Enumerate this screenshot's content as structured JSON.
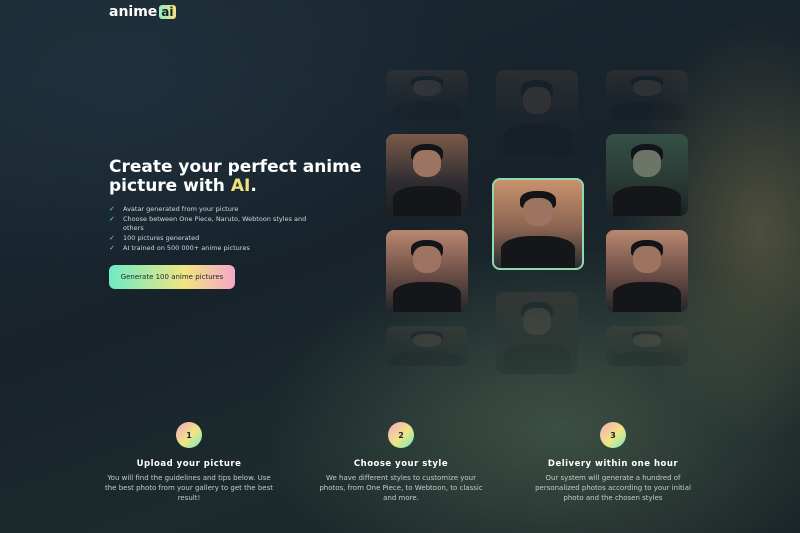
{
  "brand": {
    "name": "anime",
    "badge": "ai"
  },
  "hero": {
    "title_part1": "Create your perfect anime picture with ",
    "title_ai": "AI",
    "title_end": ".",
    "features": [
      "Avatar generated from your picture",
      "Choose between One Piece, Naruto, Webtoon styles and others",
      "100 pictures generated",
      "AI trained on 500 000+ anime pictures"
    ],
    "cta_label": "Generate 100 anime pictures"
  },
  "steps": [
    {
      "number": "1",
      "title": "Upload your picture",
      "text": "You will find the guidelines and tips below. Use the best photo from your gallery to get the best result!"
    },
    {
      "number": "2",
      "title": "Choose your style",
      "text": "We have different styles to customize your photos, from One Piece, to Webtoon, to classic and more."
    },
    {
      "number": "3",
      "title": "Delivery within one hour",
      "text": "Our system will generate a hundred of personalized photos according to your initial photo and the chosen styles"
    }
  ],
  "colors": {
    "accent_yellow": "#f0e37a",
    "accent_green": "#6eebc3",
    "accent_pink": "#f5a6c8",
    "background": "#172128"
  }
}
